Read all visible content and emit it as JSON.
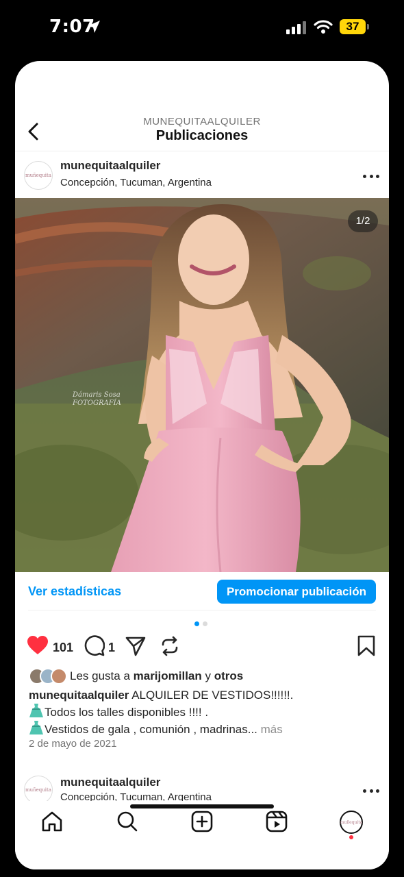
{
  "status_bar": {
    "time": "7:07",
    "battery": "37"
  },
  "header": {
    "account": "MUNEQUITAALQUILER",
    "title": "Publicaciones"
  },
  "post": {
    "username": "munequitaalquiler",
    "location": "Concepción, Tucuman, Argentina",
    "avatar_text": "muñequita",
    "photo_counter": "1/2",
    "watermark_text": "Dámaris Sosa FOTOGRAFÍA",
    "stats_link": "Ver estadísticas",
    "promote_button": "Promocionar publicación",
    "carousel_position": 1,
    "carousel_total": 2,
    "likes_count": "101",
    "comments_count": "1",
    "likes_prefix": "Les gusta a ",
    "liked_by": "marijomillan",
    "likes_and": " y ",
    "likes_others": "otros",
    "caption_user": "munequitaalquiler",
    "caption_text": " ALQUILER DE VESTIDOS!!!!!!.",
    "caption_line2": "Todos los talles disponibles !!!! .",
    "caption_line3": "Vestidos de gala , comunión , madrinas...",
    "more_label": "más",
    "date": "2 de mayo de 2021"
  },
  "next_post": {
    "username": "munequitaalquiler",
    "location": "Concepción, Tucuman, Argentina",
    "avatar_text": "muñequita"
  },
  "colors": {
    "accent": "#0095f6",
    "like_red": "#ff3040",
    "battery_yellow": "#ffd60a",
    "dress_pink": "#f0a9bf"
  },
  "icons": {
    "nav": [
      "home-icon",
      "search-icon",
      "create-icon",
      "reels-icon",
      "profile-icon"
    ],
    "post_actions": [
      "heart-icon",
      "comment-icon",
      "share-icon",
      "remix-icon",
      "bookmark-icon"
    ]
  }
}
